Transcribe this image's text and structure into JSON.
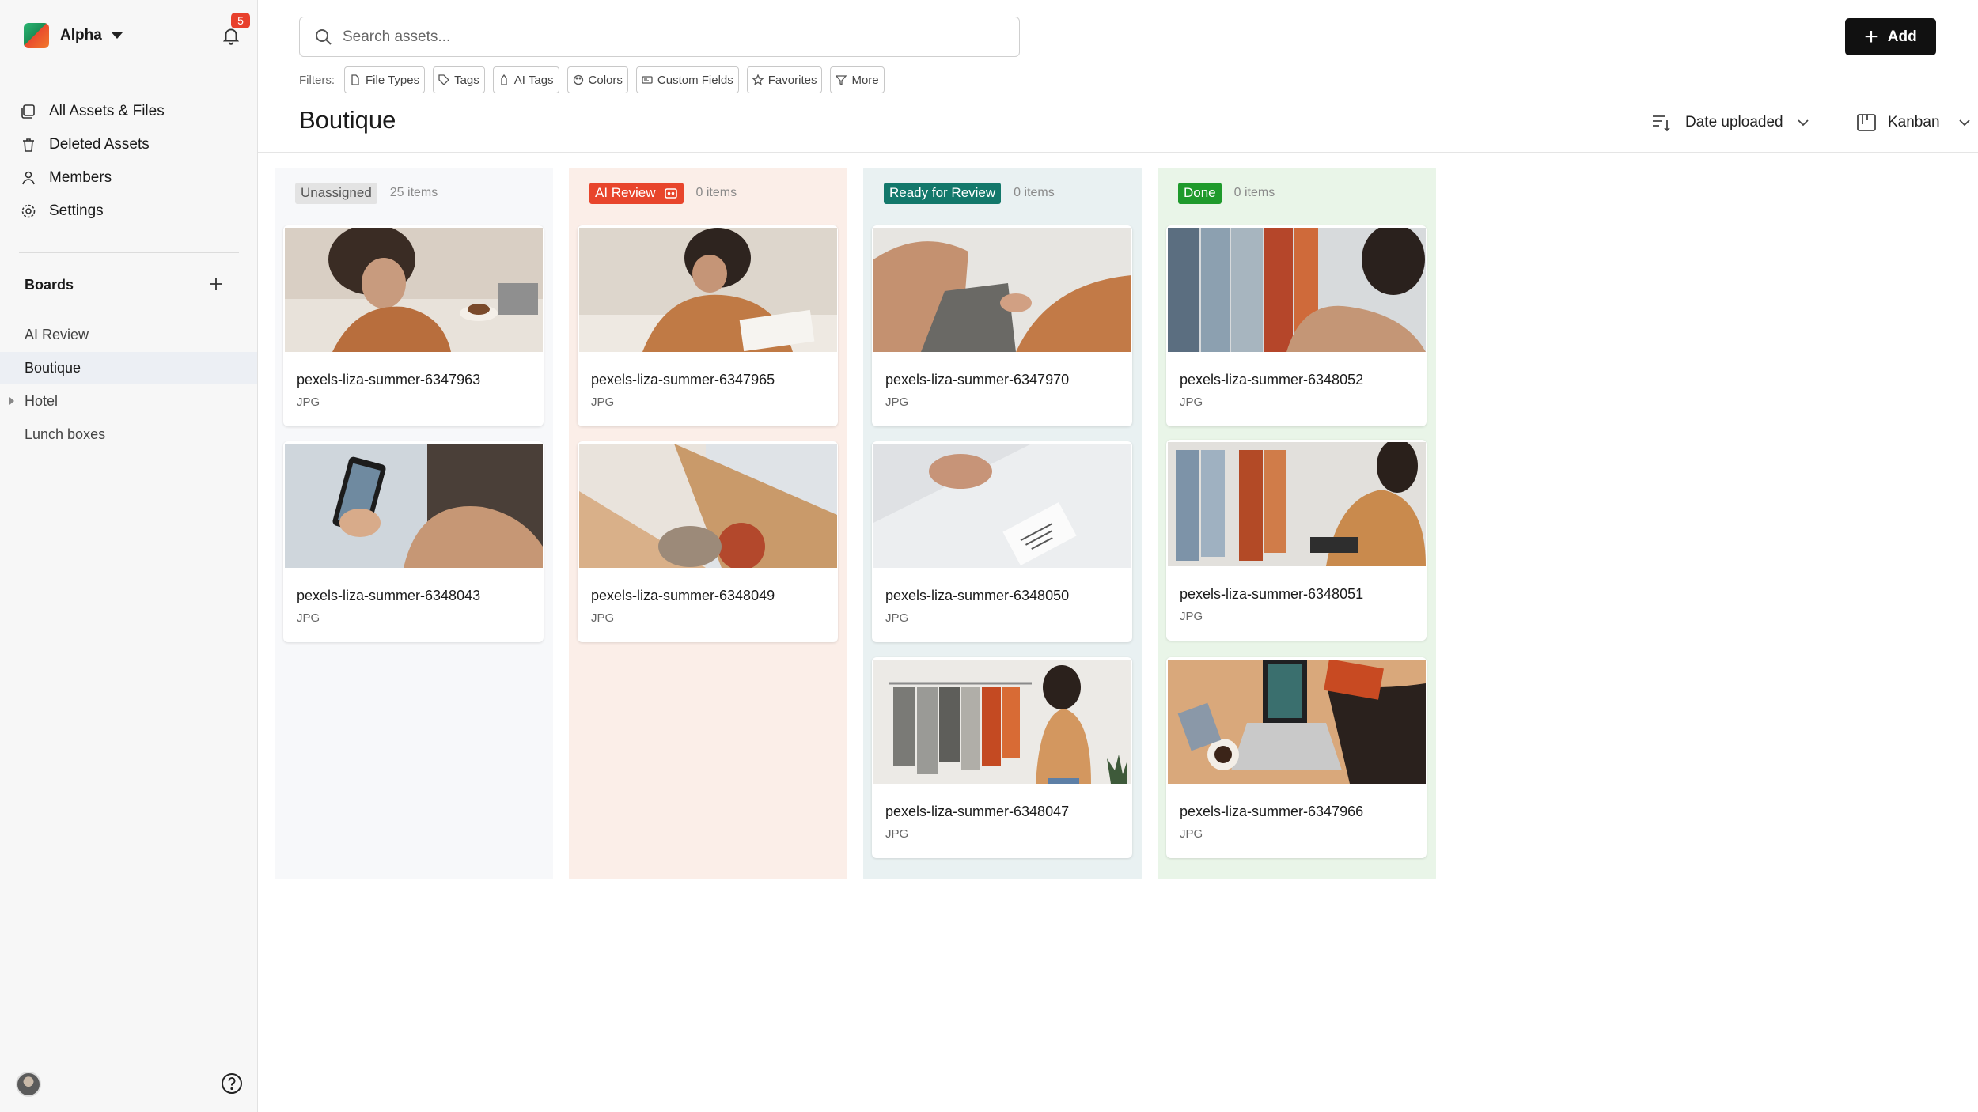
{
  "workspace": {
    "name": "Alpha",
    "notification_count": "5"
  },
  "nav": [
    {
      "label": "All Assets & Files",
      "icon": "assets-icon"
    },
    {
      "label": "Deleted Assets",
      "icon": "trash-icon"
    },
    {
      "label": "Members",
      "icon": "person-icon"
    },
    {
      "label": "Settings",
      "icon": "gear-icon"
    }
  ],
  "boards": {
    "title": "Boards",
    "items": [
      {
        "label": "AI Review"
      },
      {
        "label": "Boutique",
        "active": true
      },
      {
        "label": "Hotel",
        "expandable": true
      },
      {
        "label": "Lunch boxes"
      }
    ]
  },
  "search": {
    "placeholder": "Search assets..."
  },
  "add_button": {
    "label": "Add"
  },
  "filters": {
    "label": "Filters:",
    "chips": [
      "File Types",
      "Tags",
      "AI Tags",
      "Colors",
      "Custom Fields",
      "Favorites",
      "More"
    ]
  },
  "page": {
    "title": "Boutique"
  },
  "sort": {
    "label": "Date uploaded"
  },
  "view": {
    "label": "Kanban"
  },
  "columns": [
    {
      "status": "Unassigned",
      "count": "25 items",
      "colors": {
        "bg": "#f7f8fa",
        "badge_bg": "#e3e3e3",
        "badge_fg": "#555555"
      },
      "cards": [
        {
          "name": "pexels-liza-summer-6347963",
          "type": "JPG"
        },
        {
          "name": "pexels-liza-summer-6348043",
          "type": "JPG"
        }
      ]
    },
    {
      "status": "AI Review",
      "count": "0 items",
      "colors": {
        "bg": "#fbeee8",
        "badge_bg": "#e8452c",
        "badge_fg": "#ffffff"
      },
      "cards": [
        {
          "name": "pexels-liza-summer-6347965",
          "type": "JPG"
        },
        {
          "name": "pexels-liza-summer-6348049",
          "type": "JPG"
        }
      ]
    },
    {
      "status": "Ready for Review",
      "count": "0 items",
      "colors": {
        "bg": "#e9f1f2",
        "badge_bg": "#13786b",
        "badge_fg": "#ffffff"
      },
      "cards": [
        {
          "name": "pexels-liza-summer-6347970",
          "type": "JPG"
        },
        {
          "name": "pexels-liza-summer-6348050",
          "type": "JPG"
        },
        {
          "name": "pexels-liza-summer-6348047",
          "type": "JPG"
        }
      ]
    },
    {
      "status": "Done",
      "count": "0 items",
      "colors": {
        "bg": "#e9f5e8",
        "badge_bg": "#1f9a2c",
        "badge_fg": "#ffffff"
      },
      "cards": [
        {
          "name": "pexels-liza-summer-6348052",
          "type": "JPG"
        },
        {
          "name": "pexels-liza-summer-6348051",
          "type": "JPG"
        },
        {
          "name": "pexels-liza-summer-6347966",
          "type": "JPG"
        }
      ]
    }
  ]
}
